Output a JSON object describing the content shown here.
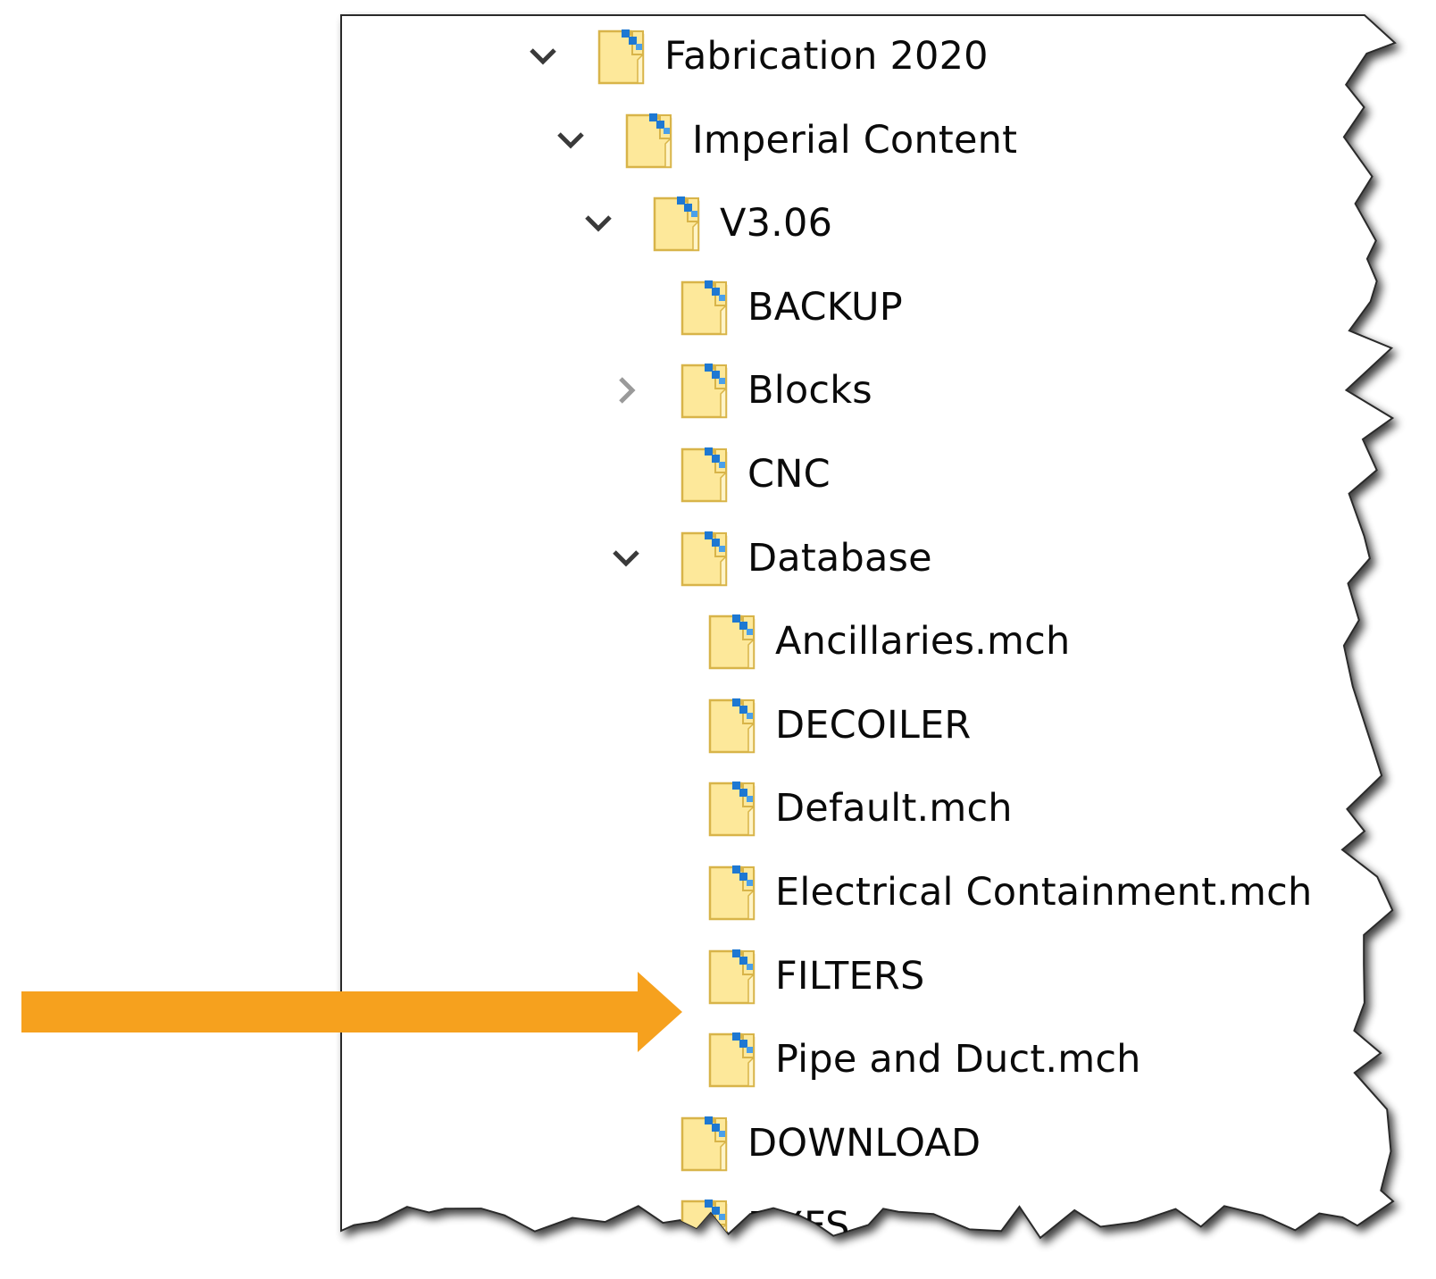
{
  "tree": {
    "items": [
      {
        "label": "Fabrication 2020",
        "level": 0,
        "toggle": "expanded"
      },
      {
        "label": "Imperial Content",
        "level": 1,
        "toggle": "expanded"
      },
      {
        "label": "V3.06",
        "level": 2,
        "toggle": "expanded"
      },
      {
        "label": "BACKUP",
        "level": 3,
        "toggle": "none"
      },
      {
        "label": "Blocks",
        "level": 3,
        "toggle": "collapsed"
      },
      {
        "label": "CNC",
        "level": 3,
        "toggle": "none"
      },
      {
        "label": "Database",
        "level": 3,
        "toggle": "expanded"
      },
      {
        "label": "Ancillaries.mch",
        "level": 4,
        "toggle": "none"
      },
      {
        "label": "DECOILER",
        "level": 4,
        "toggle": "none"
      },
      {
        "label": "Default.mch",
        "level": 4,
        "toggle": "none"
      },
      {
        "label": "Electrical Containment.mch",
        "level": 4,
        "toggle": "none"
      },
      {
        "label": "FILTERS",
        "level": 4,
        "toggle": "none",
        "highlighted": true
      },
      {
        "label": "Pipe and Duct.mch",
        "level": 4,
        "toggle": "none"
      },
      {
        "label": "DOWNLOAD",
        "level": 3,
        "toggle": "none"
      },
      {
        "label": "DXFS",
        "level": 3,
        "toggle": "none",
        "partially_visible": true
      }
    ]
  },
  "icons": {
    "folder": "shared-folder-icon",
    "expanded": "chevron-down-icon",
    "collapsed": "chevron-right-icon",
    "pointer": "orange-arrow-icon"
  },
  "colors": {
    "folder_fill": "#fde89a",
    "folder_edge": "#d8b449",
    "folder_badge": "#1e78d2",
    "arrow": "#f6a11e",
    "border": "#333333"
  }
}
